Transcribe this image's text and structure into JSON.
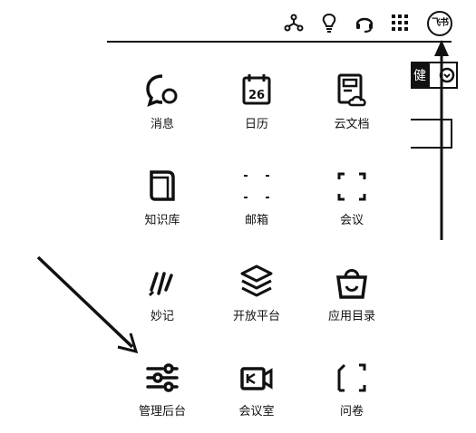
{
  "header": {
    "icons": [
      "nodes-icon",
      "lightbulb-icon",
      "headset-icon",
      "apps-grid-icon"
    ],
    "avatar_text": "飞书"
  },
  "apps": [
    {
      "label": "消息",
      "icon": "message-icon"
    },
    {
      "label": "日历",
      "icon": "calendar-icon",
      "icon_text": "26"
    },
    {
      "label": "云文档",
      "icon": "cloud-doc-icon"
    },
    {
      "label": "知识库",
      "icon": "knowledge-base-icon"
    },
    {
      "label": "邮箱",
      "icon": "mail-icon"
    },
    {
      "label": "会议",
      "icon": "meeting-icon"
    },
    {
      "label": "妙记",
      "icon": "minutes-icon"
    },
    {
      "label": "开放平台",
      "icon": "open-platform-icon"
    },
    {
      "label": "应用目录",
      "icon": "app-directory-icon"
    },
    {
      "label": "管理后台",
      "icon": "admin-console-icon"
    },
    {
      "label": "会议室",
      "icon": "meeting-room-icon"
    },
    {
      "label": "问卷",
      "icon": "survey-icon"
    }
  ],
  "side_widget_text": "健"
}
